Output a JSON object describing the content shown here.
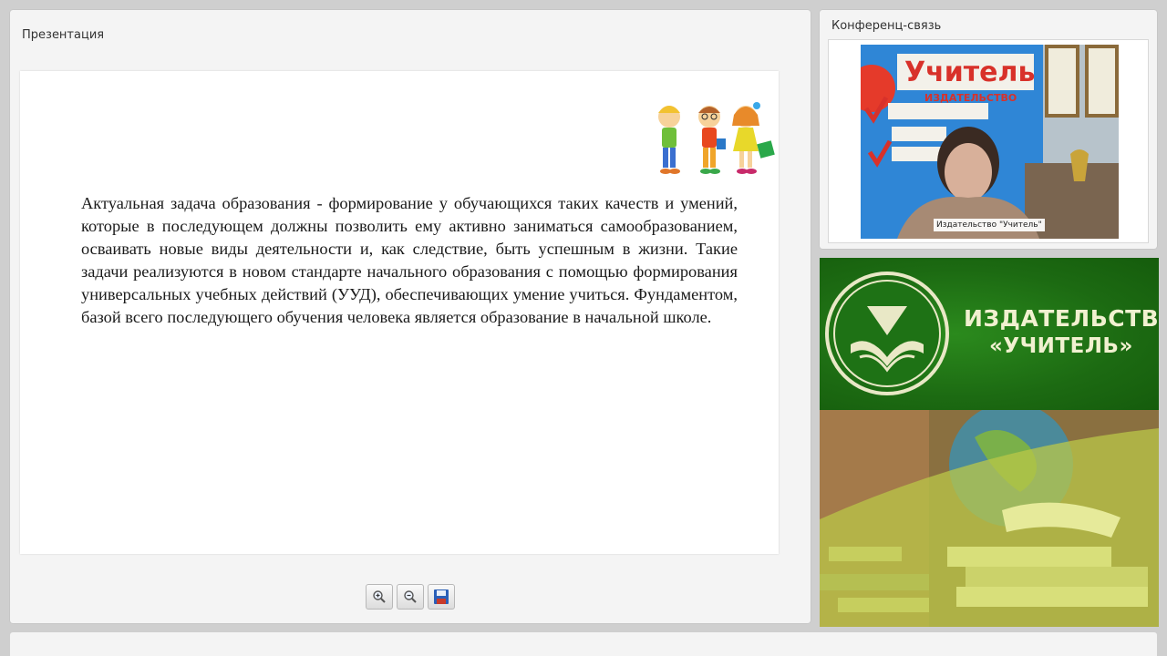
{
  "presentation": {
    "title": "Презентация",
    "slide_text": "Актуальная задача образования - формирование у обучающихся таких качеств и умений, которые в последующем должны позволить ему активно заниматься самообразованием, осваивать новые виды деятельности и, как следствие, быть успешным в жизни. Такие задачи реализуются в новом стандарте начального образования с помощью формирования универсальных учебных действий (УУД), обеспечивающих умение учиться. Фундаментом, базой всего последующего обучения человека является образование в начальной школе."
  },
  "toolbar": {
    "zoom_in_icon": "zoom-in-icon",
    "zoom_out_icon": "zoom-out-icon",
    "save_icon": "save-icon"
  },
  "conference": {
    "title": "Конференц-связь",
    "participant_label": "Издательство \"Учитель\"",
    "background_sign": "Учитель",
    "background_sub": "ИЗДАТЕЛЬСТВО"
  },
  "banner": {
    "line1": "ИЗДАТЕЛЬСТВО",
    "line2": "«УЧИТЕЛЬ»"
  },
  "colors": {
    "banner_green": "#1c6a12",
    "banner_text": "#f1f1d0",
    "brand_red": "#d8312a"
  }
}
